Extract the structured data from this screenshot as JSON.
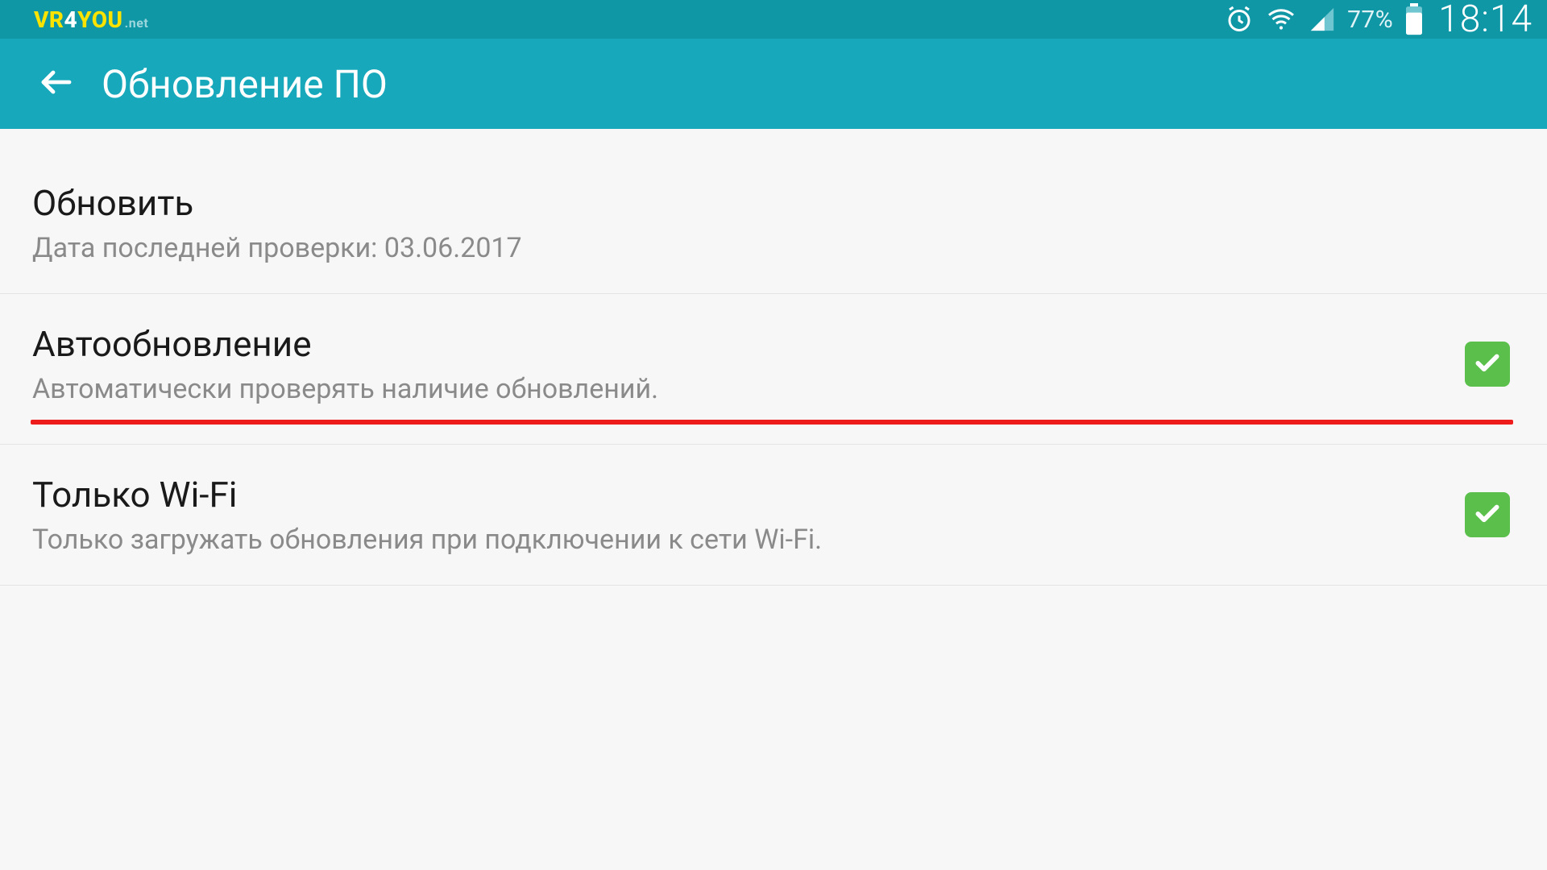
{
  "status_bar": {
    "brand": {
      "a": "VR",
      "b": "4",
      "c": "YOU",
      "d": ".net"
    },
    "battery_pct": "77%",
    "time": "18:14"
  },
  "app_bar": {
    "title": "Обновление ПО"
  },
  "rows": {
    "update": {
      "title": "Обновить",
      "sub": "Дата последней проверки: 03.06.2017"
    },
    "auto": {
      "title": "Автообновление",
      "sub": "Автоматически проверять наличие обновлений.",
      "checked": true
    },
    "wifi": {
      "title": "Только Wi-Fi",
      "sub": "Только загружать обновления при подключении к сети Wi-Fi.",
      "checked": true
    }
  }
}
